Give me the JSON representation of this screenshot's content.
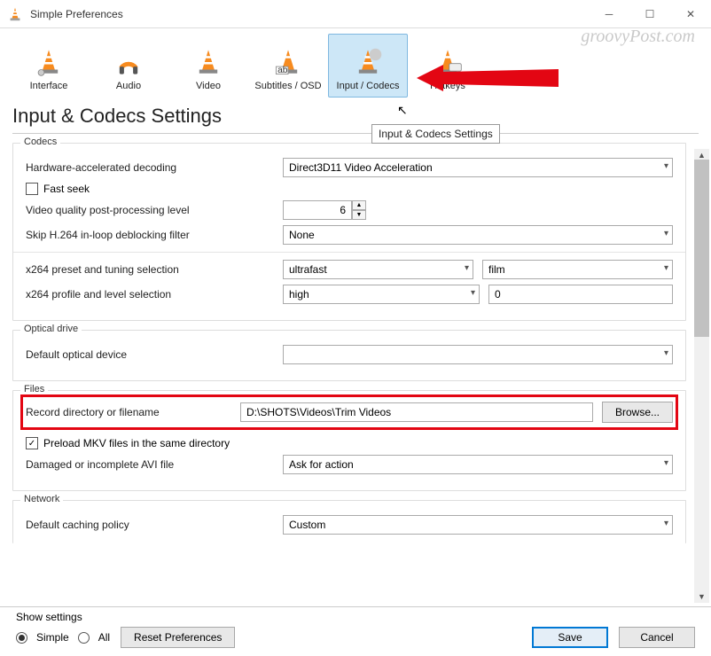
{
  "window": {
    "title": "Simple Preferences"
  },
  "watermark": "groovyPost.com",
  "tabs": [
    {
      "label": "Interface"
    },
    {
      "label": "Audio"
    },
    {
      "label": "Video"
    },
    {
      "label": "Subtitles / OSD"
    },
    {
      "label": "Input / Codecs",
      "selected": true
    },
    {
      "label": "Hotkeys"
    }
  ],
  "page": {
    "heading": "Input & Codecs Settings"
  },
  "tooltip": {
    "text": "Input & Codecs Settings"
  },
  "codecs": {
    "legend": "Codecs",
    "hw_label": "Hardware-accelerated decoding",
    "hw_value": "Direct3D11 Video Acceleration",
    "fast_seek_label": "Fast seek",
    "vq_label": "Video quality post-processing level",
    "vq_value": "6",
    "skip_label": "Skip H.264 in-loop deblocking filter",
    "skip_value": "None",
    "x264preset_label": "x264 preset and tuning selection",
    "x264preset_value": "ultrafast",
    "x264tune_value": "film",
    "x264profile_label": "x264 profile and level selection",
    "x264profile_value": "high",
    "x264level_value": "0"
  },
  "optical": {
    "legend": "Optical drive",
    "device_label": "Default optical device",
    "device_value": ""
  },
  "files": {
    "legend": "Files",
    "record_label": "Record directory or filename",
    "record_value": "D:\\SHOTS\\Videos\\Trim Videos",
    "browse_label": "Browse...",
    "preload_label": "Preload MKV files in the same directory",
    "preload_checked": true,
    "avi_label": "Damaged or incomplete AVI file",
    "avi_value": "Ask for action"
  },
  "network": {
    "legend": "Network",
    "caching_label": "Default caching policy",
    "caching_value": "Custom"
  },
  "footer": {
    "show_label": "Show settings",
    "simple_label": "Simple",
    "all_label": "All",
    "reset_label": "Reset Preferences",
    "save_label": "Save",
    "cancel_label": "Cancel"
  }
}
